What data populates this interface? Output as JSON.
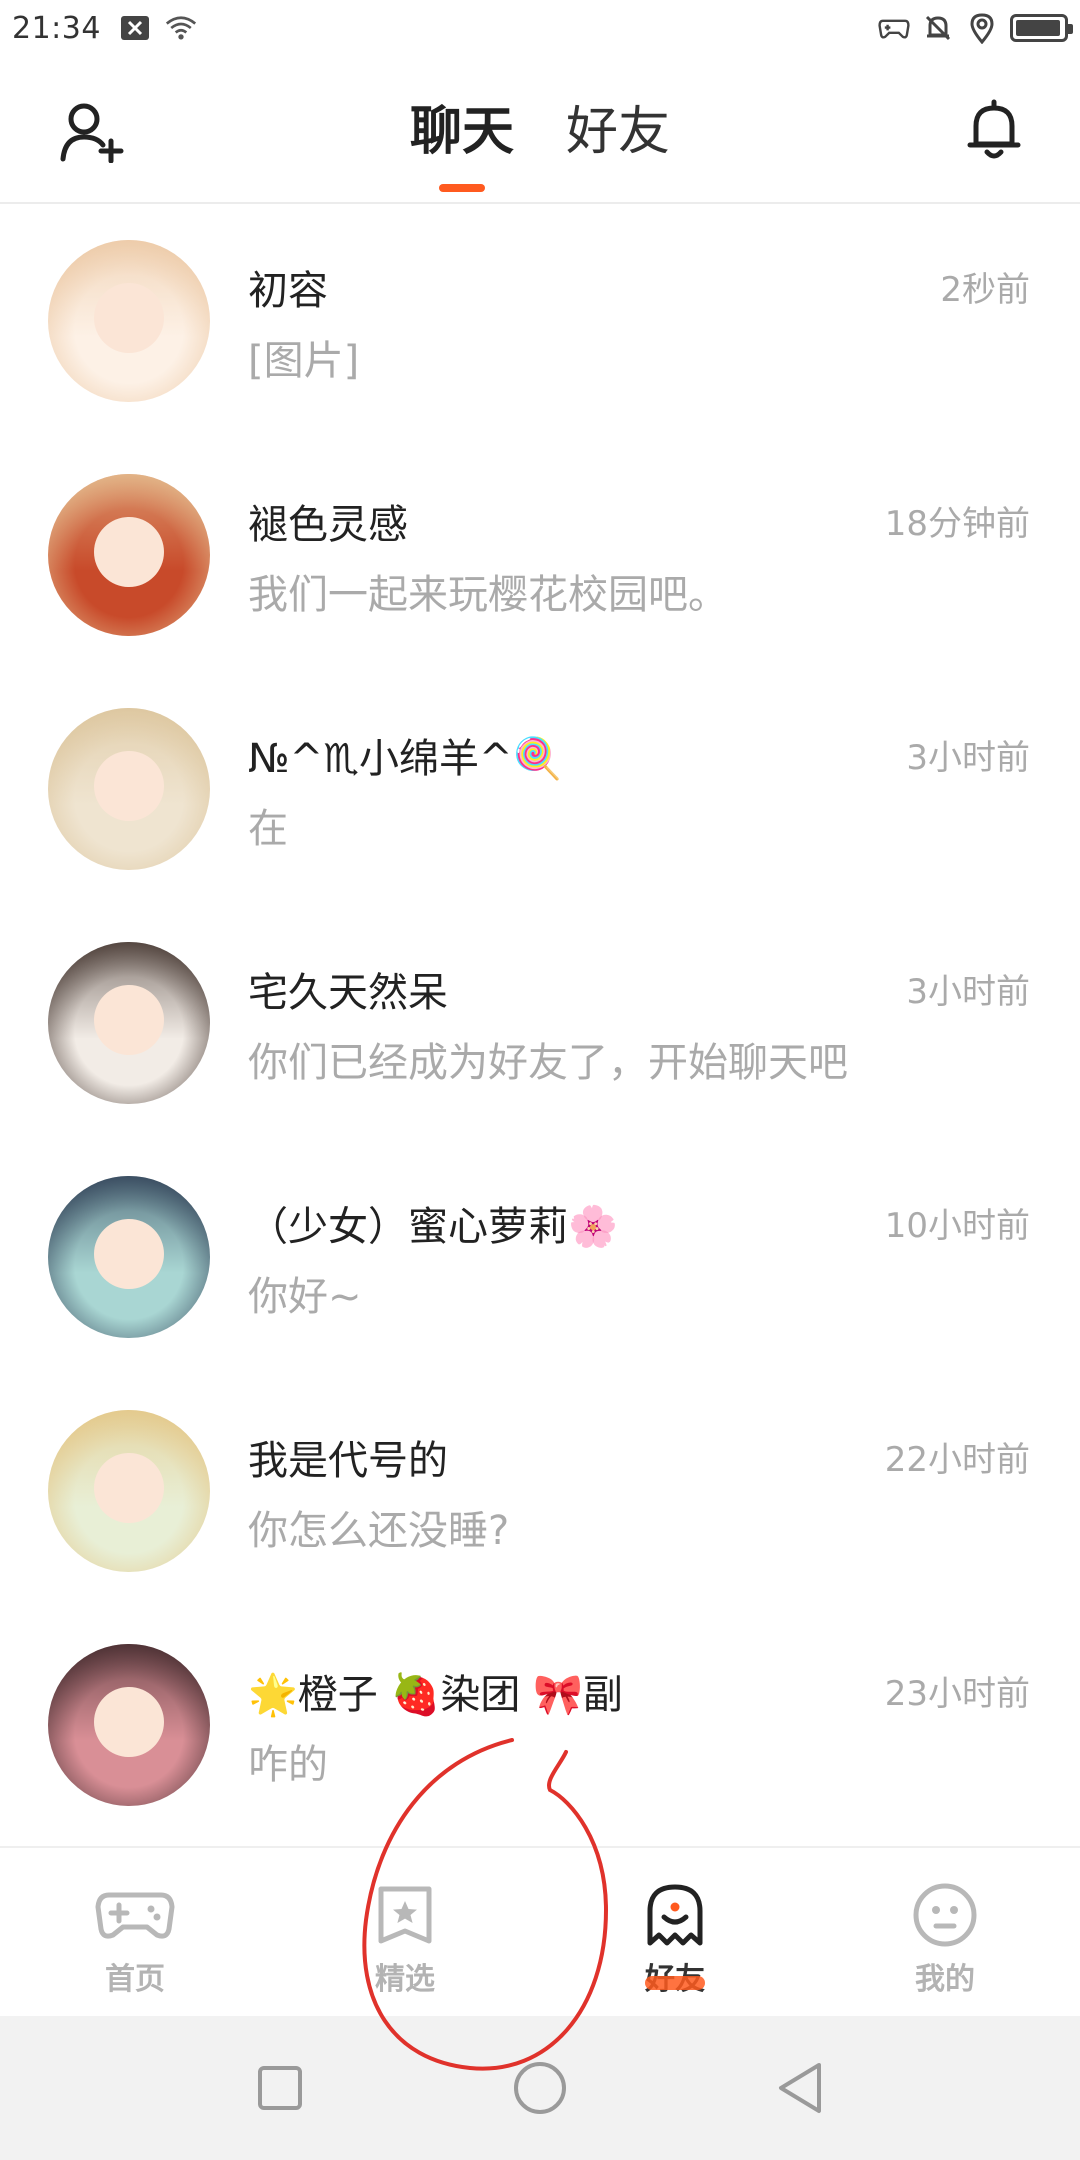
{
  "status_bar": {
    "time": "21:34",
    "left_icons": [
      "close-box-icon",
      "wifi-icon"
    ],
    "right_icons": [
      "gamepad-icon",
      "bell-muted-icon",
      "location-icon"
    ],
    "battery_level": 0.95
  },
  "header": {
    "tabs": [
      {
        "label": "聊天",
        "active": true
      },
      {
        "label": "好友",
        "active": false
      }
    ],
    "accent_color": "#ff5a1f"
  },
  "chats": [
    {
      "name": "初容",
      "preview": "[图片]",
      "time": "2秒前",
      "avatar_colors": [
        "#fdf1e6",
        "#e9c29a"
      ]
    },
    {
      "name": "褪色灵感",
      "preview": "我们一起来玩樱花校园吧。",
      "time": "18分钟前",
      "avatar_colors": [
        "#c84a2a",
        "#e9d0a0"
      ]
    },
    {
      "name": "№^♏小绵羊^🍭",
      "preview": "在",
      "time": "3小时前",
      "avatar_colors": [
        "#efe4d0",
        "#d9c094"
      ]
    },
    {
      "name": "宅久天然呆",
      "preview": "你们已经成为好友了，开始聊天吧",
      "time": "3小时前",
      "avatar_colors": [
        "#f2ece6",
        "#2a1a14"
      ]
    },
    {
      "name": "（少女）蜜心萝莉🌸",
      "preview": "你好~",
      "time": "10小时前",
      "avatar_colors": [
        "#a9d6d3",
        "#1e2a44"
      ]
    },
    {
      "name": "我是代号的",
      "preview": "你怎么还没睡?",
      "time": "22小时前",
      "avatar_colors": [
        "#e8efd6",
        "#e3c07a"
      ]
    },
    {
      "name": "🌟橙子 🍓染团 🎀副",
      "preview": "咋的",
      "time": "23小时前",
      "avatar_colors": [
        "#d98f96",
        "#2a1a1c"
      ]
    }
  ],
  "bottom_nav": [
    {
      "label": "首页",
      "icon": "gamepad-icon",
      "active": false
    },
    {
      "label": "精选",
      "icon": "star-bookmark-icon",
      "active": false
    },
    {
      "label": "好友",
      "icon": "ghost-icon",
      "active": true
    },
    {
      "label": "我的",
      "icon": "smiley-icon",
      "active": false
    }
  ],
  "system_nav": [
    "recents-square-icon",
    "home-circle-icon",
    "back-triangle-icon"
  ],
  "annotation_color": "#e0322b"
}
